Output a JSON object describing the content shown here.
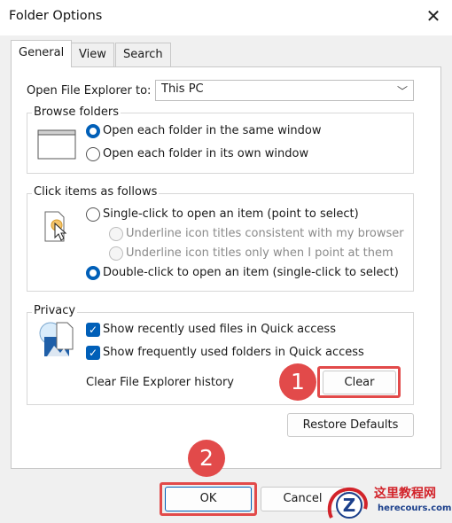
{
  "window": {
    "title": "Folder Options"
  },
  "tabs": [
    {
      "label": "General",
      "active": true
    },
    {
      "label": "View",
      "active": false
    },
    {
      "label": "Search",
      "active": false
    }
  ],
  "general": {
    "open_explorer_label": "Open File Explorer to:",
    "open_explorer_value": "This PC",
    "browse": {
      "title": "Browse folders",
      "options": [
        {
          "label": "Open each folder in the same window",
          "checked": true
        },
        {
          "label": "Open each folder in its own window",
          "checked": false
        }
      ]
    },
    "click": {
      "title": "Click items as follows",
      "single": "Single-click to open an item (point to select)",
      "sub_options": [
        "Underline icon titles consistent with my browser",
        "Underline icon titles only when I point at them"
      ],
      "double": "Double-click to open an item (single-click to select)"
    },
    "privacy": {
      "title": "Privacy",
      "checks": [
        {
          "label": "Show recently used files in Quick access",
          "checked": true
        },
        {
          "label": "Show frequently used folders in Quick access",
          "checked": true
        }
      ],
      "clear_history_label": "Clear File Explorer history",
      "clear_button": "Clear"
    },
    "restore_button": "Restore Defaults"
  },
  "footer": {
    "ok_button": "OK",
    "cancel_button": "Cancel"
  },
  "annotations": {
    "badge1": "1",
    "badge2": "2"
  },
  "watermark": {
    "text": "这里教程网",
    "url": "herecours.com",
    "logo_letter": "Z"
  },
  "colors": {
    "accent": "#005fb8",
    "highlight": "#e24a4a"
  }
}
